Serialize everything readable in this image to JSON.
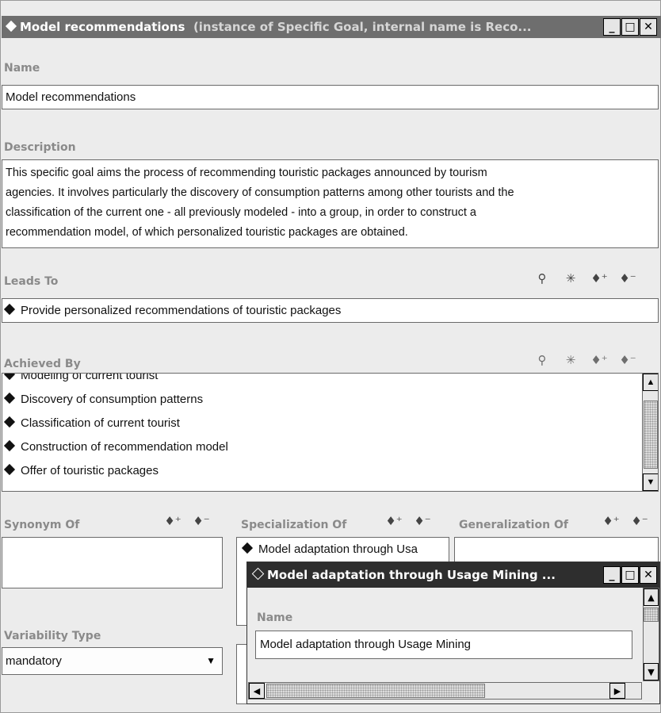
{
  "window": {
    "title": "Model recommendations",
    "subtitle": "(instance of Specific Goal, internal name is Reco...",
    "buttons": {
      "minimize": "_",
      "maximize": "□",
      "close": "✕"
    }
  },
  "name": {
    "label": "Name",
    "value": "Model recommendations"
  },
  "description": {
    "label": "Description",
    "lines": [
      "This specific goal aims the process of recommending touristic packages announced by tourism",
      "agencies. It involves particularly the discovery of consumption patterns among other tourists and the",
      "classification of the current one - all previously modeled - into a group, in order to construct a",
      "recommendation model, of which personalized touristic packages are obtained."
    ]
  },
  "leads_to": {
    "label": "Leads To",
    "items": [
      "Provide personalized recommendations of touristic packages"
    ]
  },
  "achieved_by": {
    "label": "Achieved By",
    "items": [
      "Modeling of current tourist",
      "Discovery of consumption patterns",
      "Classification of current tourist",
      "Construction of recommendation model",
      "Offer of touristic packages"
    ]
  },
  "synonym_of": {
    "label": "Synonym Of"
  },
  "specialization_of": {
    "label": "Specialization Of",
    "items": [
      "Model adaptation through Usa"
    ]
  },
  "generalization_of": {
    "label": "Generalization Of"
  },
  "variability_type": {
    "label": "Variability Type",
    "value": "mandatory"
  },
  "popup": {
    "title": "Model adaptation through Usage Mining ...",
    "name_label": "Name",
    "name_value": "Model adaptation through Usage Mining"
  },
  "colors": {
    "titlebar": "#6e6e6e",
    "label": "#8a8a8a",
    "background": "#ececec"
  }
}
